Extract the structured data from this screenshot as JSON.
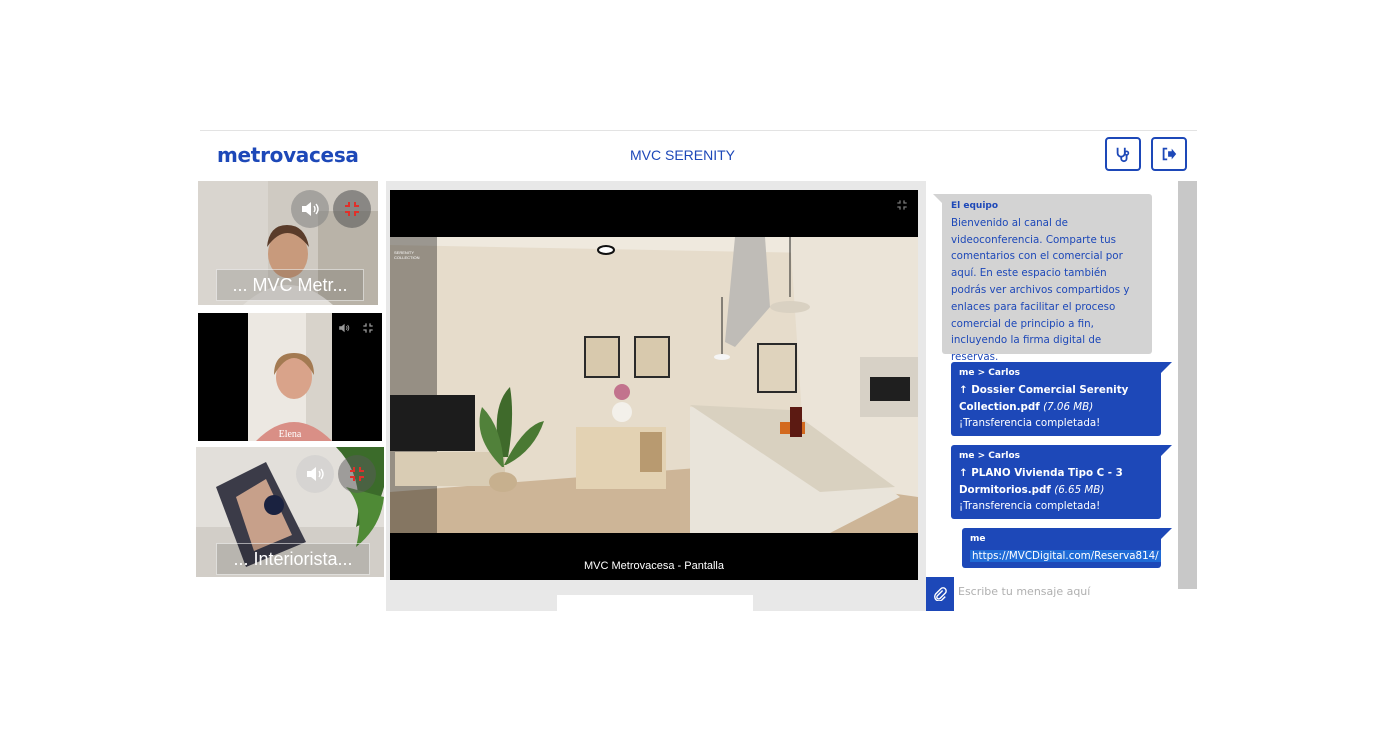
{
  "header": {
    "logo": "metrovacesa",
    "room_title": "MVC SERENITY",
    "support_icon": "stethoscope-icon",
    "exit_icon": "sign-out-icon"
  },
  "participants": [
    {
      "name": "... MVC Metr...",
      "audio_icon": "speaker-icon",
      "state_icon": "expand-icon"
    },
    {
      "name": "Elena",
      "audio_icon": "speaker-icon",
      "state_icon": "expand-icon"
    },
    {
      "name": "... Interiorista...",
      "audio_icon": "speaker-icon",
      "state_icon": "expand-icon"
    }
  ],
  "main_video": {
    "caption": "MVC Metrovacesa - Pantalla",
    "watermark": "SERENITY COLLECTION"
  },
  "chat": {
    "messages": [
      {
        "from": "El equipo",
        "text": "Bienvenido al canal de videoconferencia. Comparte tus comentarios con el comercial por aquí. En este espacio también podrás ver archivos compartidos y enlaces para facilitar el proceso comercial de principio a fin, incluyendo la firma digital de reservas."
      },
      {
        "from": "me > Carlos",
        "file": "↑ Dossier Comercial Serenity Collection.pdf",
        "size": "(7.06 MB)",
        "status": "¡Transferencia completada!"
      },
      {
        "from": "me > Carlos",
        "file": "↑ PLANO Vivienda Tipo C - 3 Dormitorios.pdf",
        "size": "(6.65 MB)",
        "status": "¡Transferencia completada!"
      },
      {
        "from": "me",
        "link": "https://MVCDigital.com/Reserva814/"
      }
    ],
    "input_placeholder": "Escribe tu mensaje aquí",
    "attach_icon": "paperclip-icon"
  },
  "colors": {
    "brand": "#1d48b8",
    "bubble_in": "#d3d3d3"
  }
}
